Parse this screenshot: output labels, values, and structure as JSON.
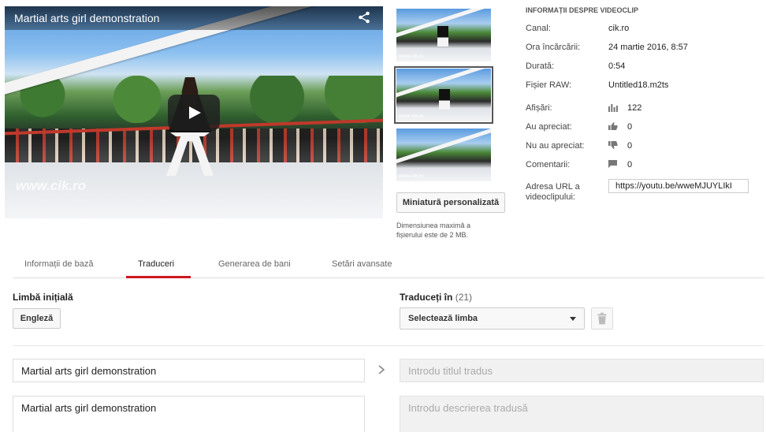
{
  "video": {
    "title": "Martial arts girl demonstration",
    "watermark": "www.cik.ro",
    "share_icon": "share-icon",
    "play_icon": "play-icon"
  },
  "thumbnails": {
    "items": [
      {
        "watermark": "www.cik.ro",
        "selected": false
      },
      {
        "watermark": "www.cik.ro",
        "selected": true
      },
      {
        "watermark": "www.cik.ro",
        "selected": false
      }
    ],
    "custom_button_label": "Miniatură personalizată",
    "max_size_note": "Dimensiunea maximă a fișierului este de 2 MB."
  },
  "info": {
    "heading": "INFORMAȚII DESPRE VIDEOCLIP",
    "channel_label": "Canal:",
    "channel_value": "cik.ro",
    "upload_label": "Ora încărcării:",
    "upload_value": "24 martie 2016, 8:57",
    "duration_label": "Durată:",
    "duration_value": "0:54",
    "raw_label": "Fișier RAW:",
    "raw_value": "Untitled18.m2ts",
    "views_label": "Afișări:",
    "views_value": "122",
    "likes_label": "Au apreciat:",
    "likes_value": "0",
    "dislikes_label": "Nu au apreciat:",
    "dislikes_value": "0",
    "comments_label": "Comentarii:",
    "comments_value": "0",
    "url_label": "Adresa URL a videoclipului:",
    "url_value": "https://youtu.be/wweMJUYLIkI"
  },
  "tabs": [
    {
      "label": "Informații de bază",
      "active": false
    },
    {
      "label": "Traduceri",
      "active": true
    },
    {
      "label": "Generarea de bani",
      "active": false
    },
    {
      "label": "Setări avansate",
      "active": false
    }
  ],
  "translate": {
    "source_heading": "Limbă inițială",
    "source_language": "Engleză",
    "target_heading": "Traduceți în",
    "target_count": "(21)",
    "select_placeholder": "Selectează limba",
    "title_value": "Martial arts girl demonstration",
    "title_placeholder": "Introdu titlul tradus",
    "description_value": "Martial arts girl demonstration",
    "description_placeholder": "Introdu descrierea tradusă"
  },
  "colors": {
    "accent_red": "#cc181e",
    "text": "#222222",
    "muted": "#666666"
  }
}
